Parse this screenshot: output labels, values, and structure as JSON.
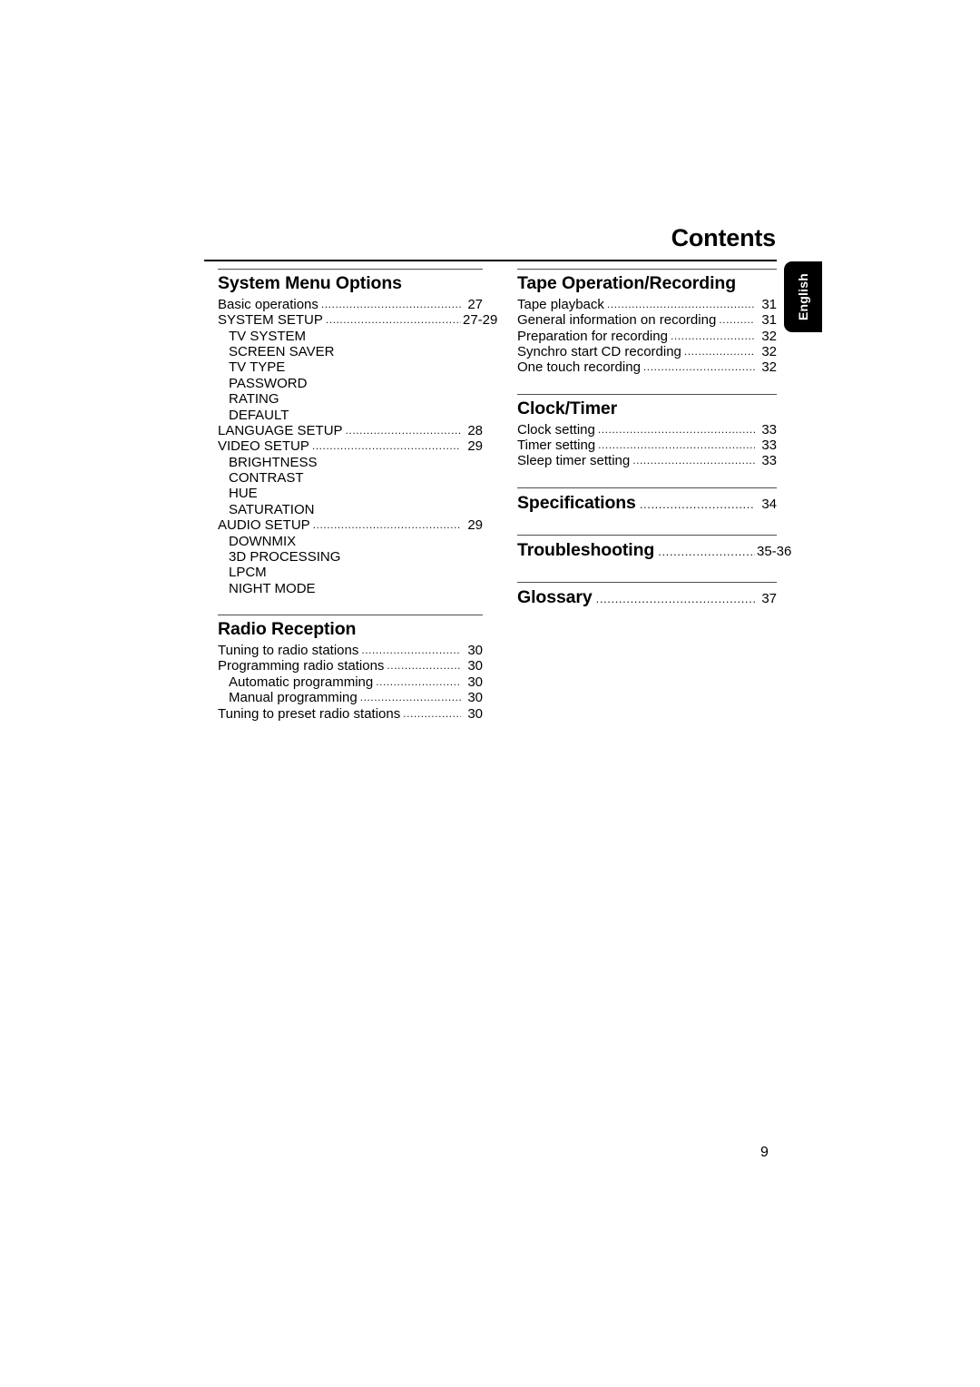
{
  "header": {
    "title": "Contents"
  },
  "language_tab": {
    "label": "English"
  },
  "footer": {
    "page_number": "9"
  },
  "leader": "..................................................................................................",
  "columns": {
    "left": [
      {
        "heading": "System Menu Options",
        "heading_page": null,
        "entries": [
          {
            "text": "Basic operations",
            "page": "27",
            "indent": false,
            "leader": true
          },
          {
            "text": "SYSTEM SETUP",
            "page": "27-29",
            "indent": false,
            "leader": true
          },
          {
            "text": "TV SYSTEM",
            "page": "",
            "indent": true,
            "leader": false
          },
          {
            "text": "SCREEN SAVER",
            "page": "",
            "indent": true,
            "leader": false
          },
          {
            "text": "TV TYPE",
            "page": "",
            "indent": true,
            "leader": false
          },
          {
            "text": "PASSWORD",
            "page": "",
            "indent": true,
            "leader": false
          },
          {
            "text": "RATING",
            "page": "",
            "indent": true,
            "leader": false
          },
          {
            "text": "DEFAULT",
            "page": "",
            "indent": true,
            "leader": false
          },
          {
            "text": "LANGUAGE SETUP",
            "page": "28",
            "indent": false,
            "leader": true
          },
          {
            "text": "VIDEO SETUP",
            "page": "29",
            "indent": false,
            "leader": true
          },
          {
            "text": "BRIGHTNESS",
            "page": "",
            "indent": true,
            "leader": false
          },
          {
            "text": "CONTRAST",
            "page": "",
            "indent": true,
            "leader": false
          },
          {
            "text": "HUE",
            "page": "",
            "indent": true,
            "leader": false
          },
          {
            "text": "SATURATION",
            "page": "",
            "indent": true,
            "leader": false
          },
          {
            "text": "AUDIO SETUP",
            "page": "29",
            "indent": false,
            "leader": true
          },
          {
            "text": "DOWNMIX",
            "page": "",
            "indent": true,
            "leader": false
          },
          {
            "text": "3D PROCESSING",
            "page": "",
            "indent": true,
            "leader": false
          },
          {
            "text": "LPCM",
            "page": "",
            "indent": true,
            "leader": false
          },
          {
            "text": "NIGHT MODE",
            "page": "",
            "indent": true,
            "leader": false
          }
        ]
      },
      {
        "heading": "Radio Reception",
        "heading_page": null,
        "entries": [
          {
            "text": "Tuning to radio stations",
            "page": "30",
            "indent": false,
            "leader": true
          },
          {
            "text": "Programming radio stations",
            "page": "30",
            "indent": false,
            "leader": true
          },
          {
            "text": "Automatic programming",
            "page": "30",
            "indent": true,
            "leader": true
          },
          {
            "text": "Manual programming",
            "page": "30",
            "indent": true,
            "leader": true
          },
          {
            "text": "Tuning to preset radio stations",
            "page": "30",
            "indent": false,
            "leader": true
          }
        ]
      }
    ],
    "right": [
      {
        "heading": "Tape Operation/Recording",
        "heading_page": null,
        "entries": [
          {
            "text": "Tape playback",
            "page": "31",
            "indent": false,
            "leader": true
          },
          {
            "text": "General information on recording",
            "page": "31",
            "indent": false,
            "leader": true
          },
          {
            "text": "Preparation for recording",
            "page": "32",
            "indent": false,
            "leader": true
          },
          {
            "text": "Synchro start CD recording",
            "page": "32",
            "indent": false,
            "leader": true
          },
          {
            "text": "One touch recording",
            "page": "32",
            "indent": false,
            "leader": true
          }
        ]
      },
      {
        "heading": "Clock/Timer",
        "heading_page": null,
        "entries": [
          {
            "text": "Clock setting",
            "page": "33",
            "indent": false,
            "leader": true
          },
          {
            "text": "Timer setting",
            "page": "33",
            "indent": false,
            "leader": true
          },
          {
            "text": "Sleep timer setting",
            "page": "33",
            "indent": false,
            "leader": true
          }
        ]
      },
      {
        "heading": "Specifications",
        "heading_page": "34",
        "entries": []
      },
      {
        "heading": "Troubleshooting",
        "heading_page": "35-36",
        "entries": []
      },
      {
        "heading": "Glossary",
        "heading_page": "37",
        "entries": []
      }
    ]
  }
}
